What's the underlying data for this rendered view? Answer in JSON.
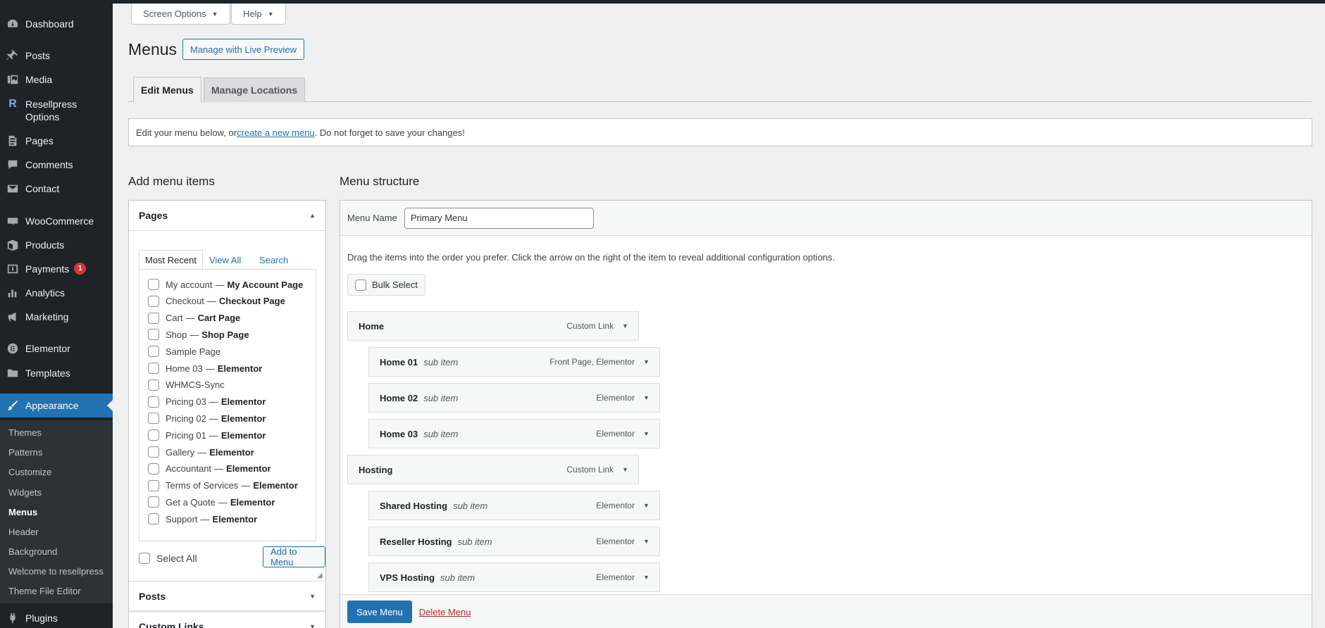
{
  "sidebar": {
    "items": [
      {
        "label": "Dashboard",
        "icon": "dashboard-icon"
      },
      {
        "label": "Posts",
        "icon": "pin-icon"
      },
      {
        "label": "Media",
        "icon": "media-icon"
      },
      {
        "label": "Resellpress Options",
        "icon": "resellpress-r-icon"
      },
      {
        "label": "Pages",
        "icon": "pages-icon"
      },
      {
        "label": "Comments",
        "icon": "comments-icon"
      },
      {
        "label": "Contact",
        "icon": "mail-icon"
      },
      {
        "label": "WooCommerce",
        "icon": "woo-icon"
      },
      {
        "label": "Products",
        "icon": "box-icon"
      },
      {
        "label": "Payments",
        "icon": "dollar-icon",
        "badge": "1"
      },
      {
        "label": "Analytics",
        "icon": "bar-chart-icon"
      },
      {
        "label": "Marketing",
        "icon": "megaphone-icon"
      },
      {
        "label": "Elementor",
        "icon": "elementor-icon"
      },
      {
        "label": "Templates",
        "icon": "folder-icon"
      },
      {
        "label": "Appearance",
        "icon": "brush-icon"
      },
      {
        "label": "Plugins",
        "icon": "plug-icon"
      }
    ],
    "submenu": [
      "Themes",
      "Patterns",
      "Customize",
      "Widgets",
      "Menus",
      "Header",
      "Background",
      "Welcome to resellpress",
      "Theme File Editor"
    ],
    "colors": {
      "bg": "#1d2327",
      "active": "#2271b1",
      "badge": "#d63638"
    }
  },
  "header": {
    "screen_options": "Screen Options",
    "help": "Help",
    "title": "Menus",
    "live_preview": "Manage with Live Preview"
  },
  "tabs": [
    {
      "label": "Edit Menus",
      "active": true
    },
    {
      "label": "Manage Locations",
      "active": false
    }
  ],
  "notice": {
    "pre": "Edit your menu below, or ",
    "link": "create a new menu",
    "post": ". Do not forget to save your changes!"
  },
  "add_items": {
    "title": "Add menu items",
    "pages_head": "Pages",
    "inner_tabs": [
      "Most Recent",
      "View All",
      "Search"
    ],
    "pages": [
      {
        "name": "My account",
        "state": "My Account Page"
      },
      {
        "name": "Checkout",
        "state": "Checkout Page"
      },
      {
        "name": "Cart",
        "state": "Cart Page"
      },
      {
        "name": "Shop",
        "state": "Shop Page"
      },
      {
        "name": "Sample Page",
        "state": ""
      },
      {
        "name": "Home 03",
        "state": "Elementor"
      },
      {
        "name": "WHMCS-Sync",
        "state": ""
      },
      {
        "name": "Pricing 03",
        "state": "Elementor"
      },
      {
        "name": "Pricing 02",
        "state": "Elementor"
      },
      {
        "name": "Pricing 01",
        "state": "Elementor"
      },
      {
        "name": "Gallery",
        "state": "Elementor"
      },
      {
        "name": "Accountant",
        "state": "Elementor"
      },
      {
        "name": "Terms of Services",
        "state": "Elementor"
      },
      {
        "name": "Get a Quote",
        "state": "Elementor"
      },
      {
        "name": "Support",
        "state": "Elementor"
      }
    ],
    "separator": "—",
    "select_all": "Select All",
    "add_to_menu": "Add to Menu",
    "posts_head": "Posts",
    "custom_links_head": "Custom Links"
  },
  "structure": {
    "title": "Menu structure",
    "name_label": "Menu Name",
    "name_value": "Primary Menu",
    "hint": "Drag the items into the order you prefer. Click the arrow on the right of the item to reveal additional configuration options.",
    "bulk_select": "Bulk Select",
    "items": [
      {
        "title": "Home",
        "sub": "",
        "type": "Custom Link",
        "depth": 0
      },
      {
        "title": "Home 01",
        "sub": "sub item",
        "type": "Front Page, Elementor",
        "depth": 1
      },
      {
        "title": "Home 02",
        "sub": "sub item",
        "type": "Elementor",
        "depth": 1
      },
      {
        "title": "Home 03",
        "sub": "sub item",
        "type": "Elementor",
        "depth": 1
      },
      {
        "title": "Hosting",
        "sub": "",
        "type": "Custom Link",
        "depth": 0
      },
      {
        "title": "Shared Hosting",
        "sub": "sub item",
        "type": "Elementor",
        "depth": 1
      },
      {
        "title": "Reseller Hosting",
        "sub": "sub item",
        "type": "Elementor",
        "depth": 1
      },
      {
        "title": "VPS Hosting",
        "sub": "sub item",
        "type": "Elementor",
        "depth": 1
      }
    ],
    "save": "Save Menu",
    "delete": "Delete Menu"
  }
}
